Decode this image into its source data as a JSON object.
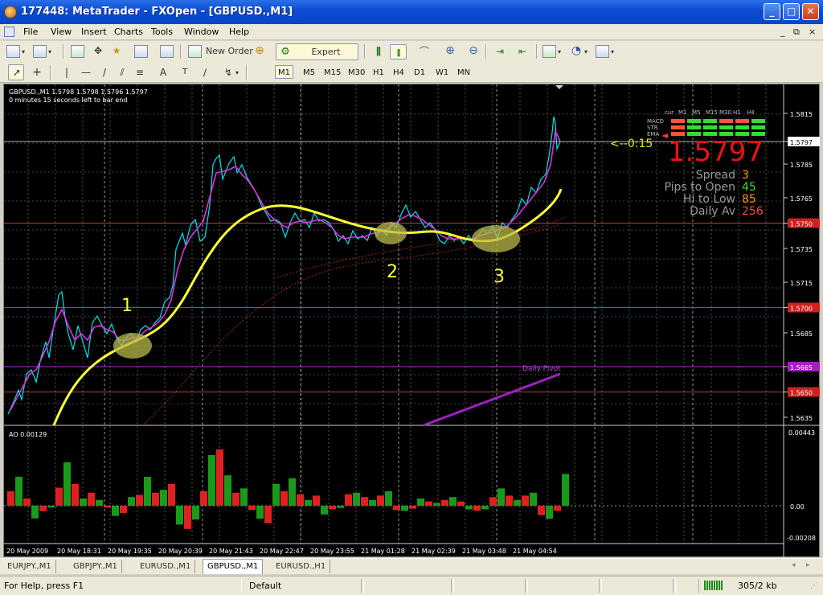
{
  "window": {
    "title": "177448: MetaTrader - FXOpen - [GBPUSD.,M1]"
  },
  "menu": [
    "File",
    "View",
    "Insert",
    "Charts",
    "Tools",
    "Window",
    "Help"
  ],
  "mdi_controls": [
    "_",
    "×"
  ],
  "toolbar": {
    "new_order_label": "New Order",
    "expert_advisors_label": "Expert Advisors",
    "timeframes": [
      "M1",
      "M5",
      "M15",
      "M30",
      "H1",
      "H4",
      "D1",
      "W1",
      "MN"
    ],
    "active_timeframe": "M1"
  },
  "chart": {
    "header_line1": "GBPUSD.,M1  1.5798 1.5798 1.5796 1.5797",
    "header_line2": "0 minutes 15 seconds left to bar end",
    "price_labels": [
      "1.5815",
      "1.5797",
      "1.5785",
      "1.5765",
      "1.5750",
      "1.5735",
      "1.5715",
      "1.5700",
      "1.5685",
      "1.5665",
      "1.5650",
      "1.5635"
    ],
    "highlighted_prices": {
      "1.5797": "#ffffff",
      "1.5750": "#d02020",
      "1.5700": "#d02020",
      "1.5665": "#a020c0",
      "1.5650": "#d02020"
    },
    "current_price": "1.5797",
    "countdown": "<--0:15",
    "big_price": "1.5797",
    "stats": [
      {
        "label": "Spread",
        "value": "3",
        "color": "#ff9900"
      },
      {
        "label": "Pips to Open",
        "value": "45",
        "color": "#33dd33"
      },
      {
        "label": "Hi to Low",
        "value": "85",
        "color": "#ff9900"
      },
      {
        "label": "Daily Av",
        "value": "256",
        "color": "#ff4444"
      }
    ],
    "signal_headers": [
      "cur",
      "M1",
      "M5",
      "M15",
      "M30",
      "H1",
      "H4"
    ],
    "signal_rows": [
      {
        "name": "MACD",
        "colors": [
          "#ff5533",
          "#33dd33",
          "#33dd33",
          "#ff5533",
          "#ff5533",
          "#33dd33"
        ]
      },
      {
        "name": "STR",
        "colors": [
          "#ff5533",
          "#33dd33",
          "#33dd33",
          "#33dd33",
          "#33dd33",
          "#33dd33"
        ]
      },
      {
        "name": "EMA",
        "colors": [
          "#ff5533",
          "#33dd33",
          "#33dd33",
          "#33dd33",
          "#33dd33",
          "#33dd33"
        ]
      }
    ],
    "markers": [
      "1",
      "2",
      "3"
    ],
    "daily_pivot_label": "Daily Pivot",
    "ao_label": "AO 0.00129",
    "ao_scale": [
      "0.00443",
      "0.00",
      "-0.00208"
    ],
    "time_labels": [
      "20 May 2009",
      "20 May 18:31",
      "20 May 19:35",
      "20 May 20:39",
      "20 May 21:43",
      "20 May 22:47",
      "20 May 23:55",
      "21 May 01:28",
      "21 May 02:39",
      "21 May 03:48",
      "21 May 04:54"
    ]
  },
  "tabs": [
    "EURJPY.,M1",
    "GBPJPY.,M1",
    "EURUSD.,M1",
    "GBPUSD.,M1",
    "EURUSD.,H1"
  ],
  "active_tab": "GBPUSD.,M1",
  "status": {
    "help": "For Help, press F1",
    "profile": "Default",
    "traffic": "305/2 kb"
  }
}
